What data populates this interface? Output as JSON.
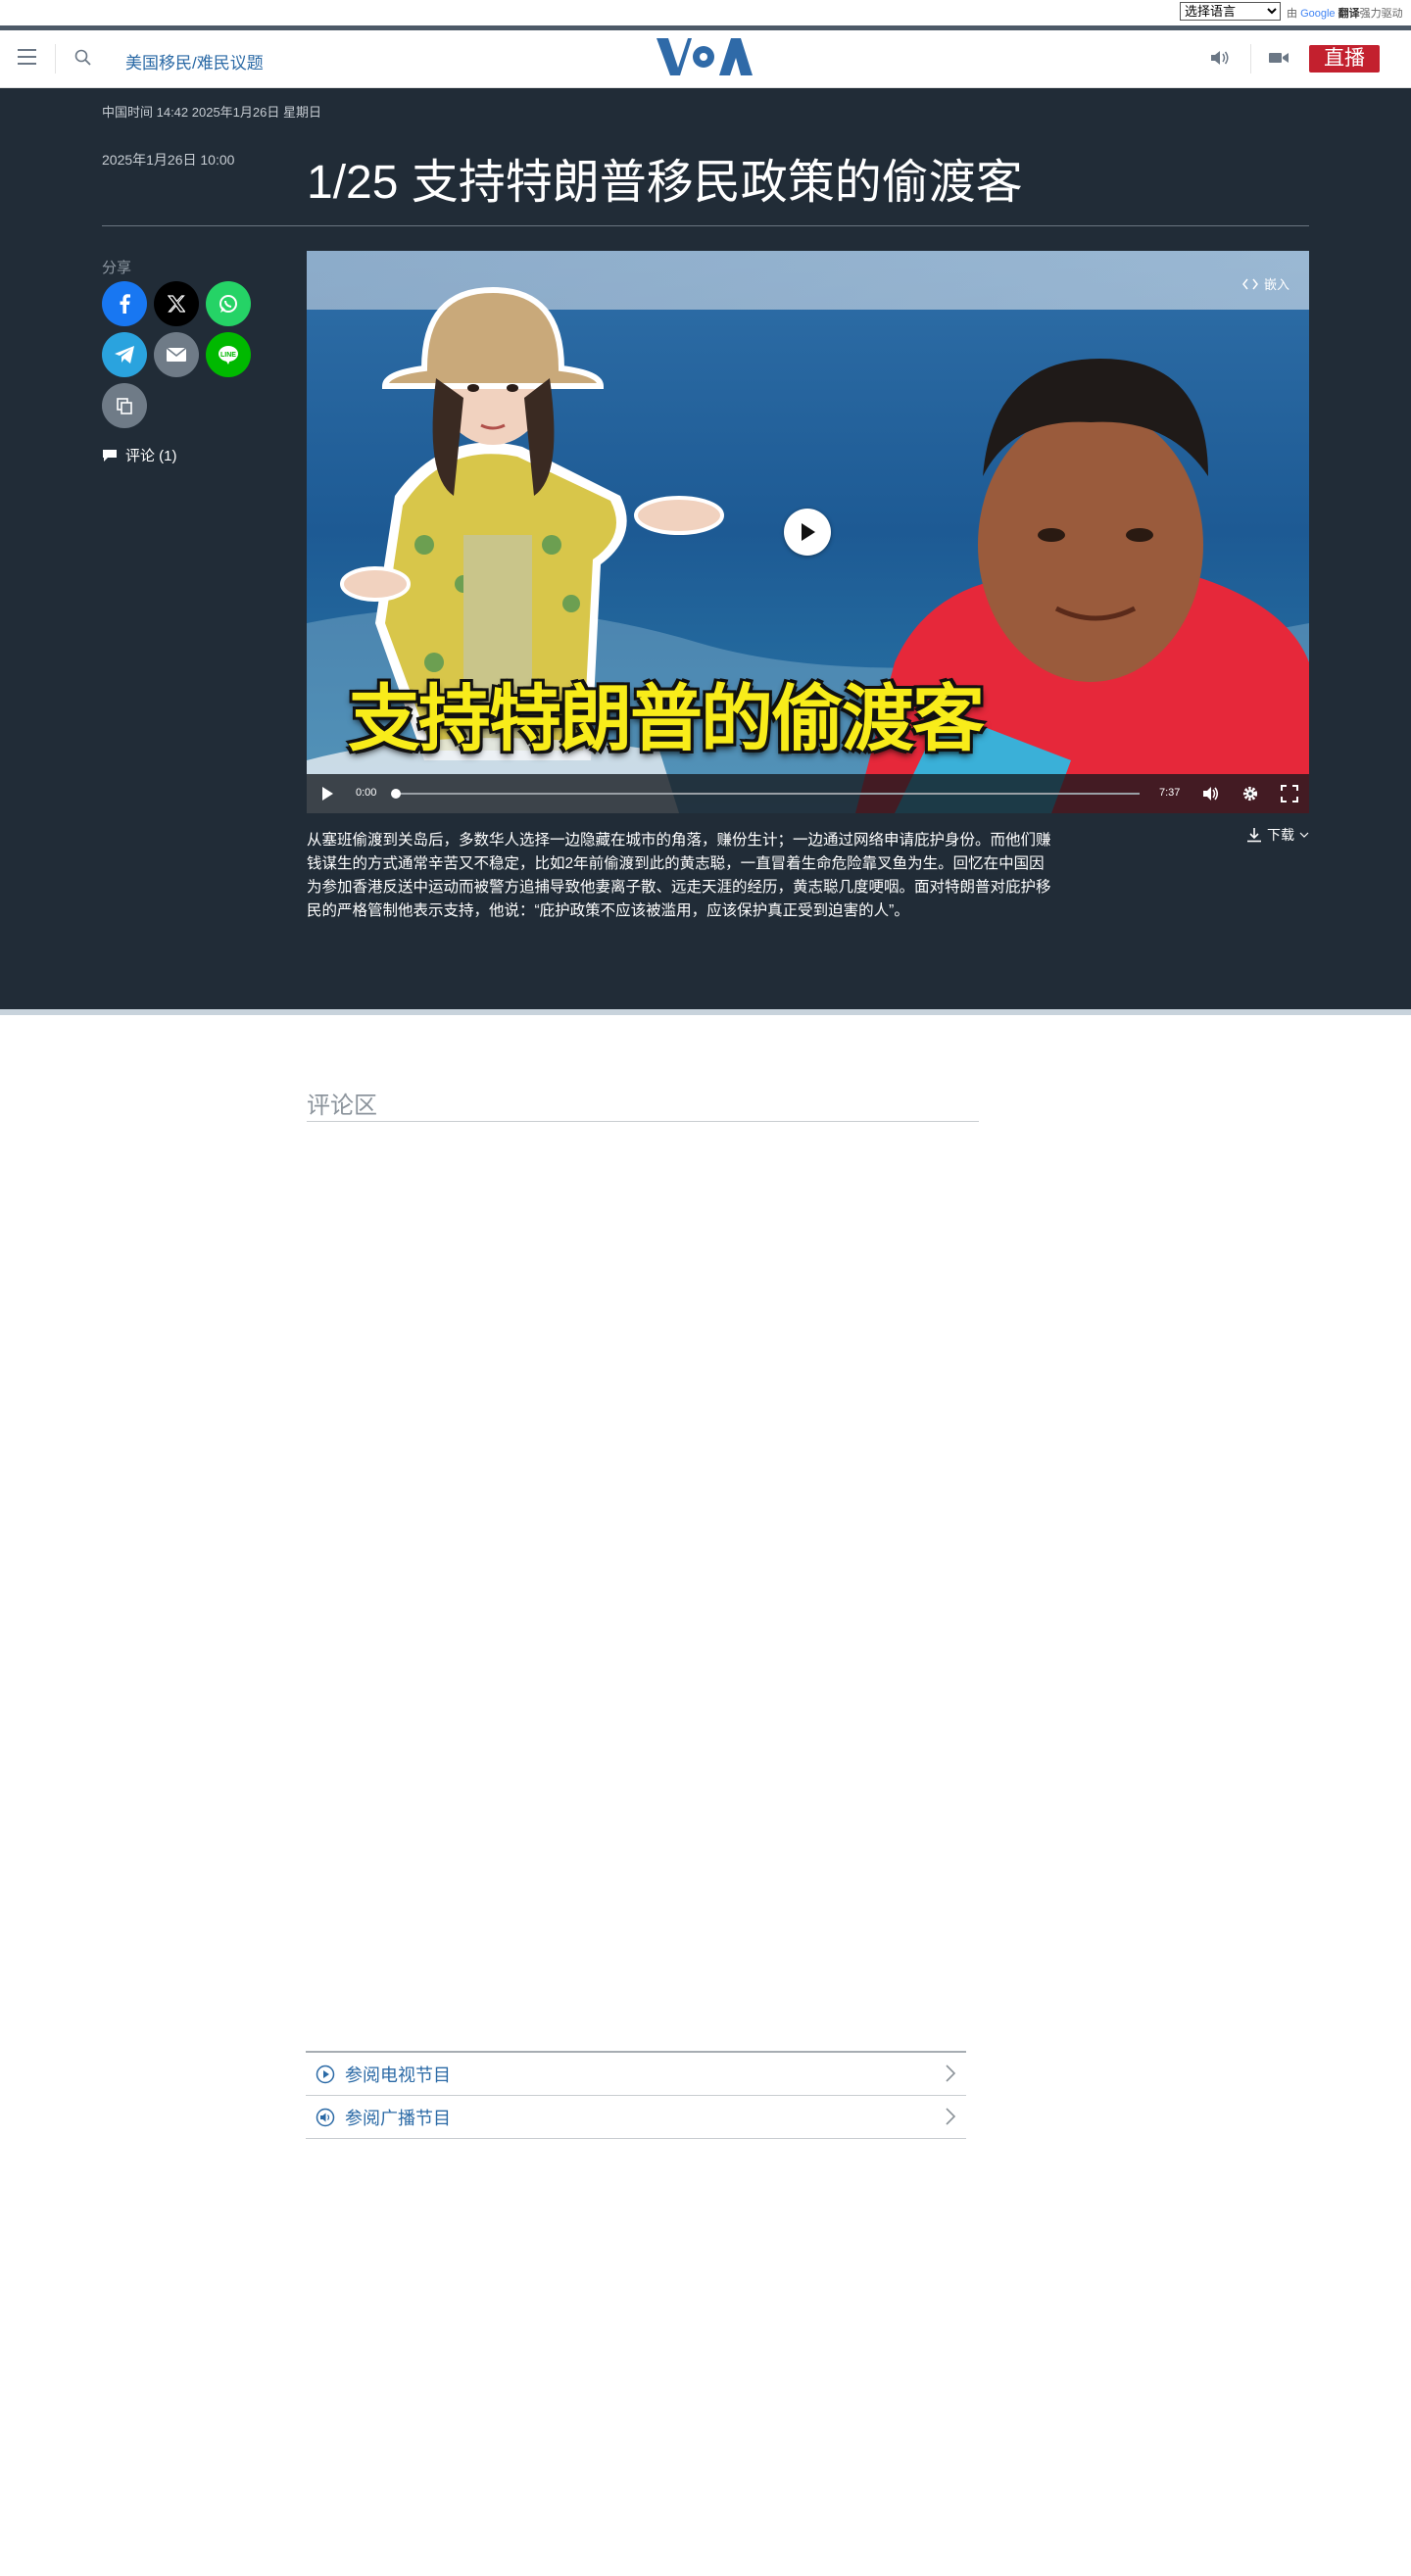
{
  "translate": {
    "select_value": "选择语言",
    "credit_prefix": "由",
    "credit_google": "Google",
    "credit_translate": "翻译",
    "credit_suffix": "强力驱动"
  },
  "header": {
    "section_link": "美国移民/难民议题",
    "logo_text": "VOA",
    "live_label": "直播",
    "icons": [
      "hamburger-icon",
      "search-icon",
      "speaker-icon",
      "video-camera-icon"
    ]
  },
  "article": {
    "timestamp_top": "中国时间 14:42 2025年1月26日 星期日",
    "date_published": "2025年1月26日 10:00",
    "title": "1/25 支持特朗普移民政策的偷渡客",
    "share_label": "分享",
    "share_buttons": [
      "facebook",
      "x",
      "whatsapp",
      "telegram",
      "email",
      "line",
      "copy-link"
    ],
    "comments_link": "评论 (1)",
    "description": "从塞班偷渡到关岛后，多数华人选择一边隐藏在城市的角落，赚份生计；一边通过网络申请庇护身份。而他们赚钱谋生的方式通常辛苦又不稳定，比如2年前偷渡到此的黄志聪，一直冒着生命危险靠叉鱼为生。回忆在中国因为参加香港反送中运动而被警方追捕导致他妻离子散、远走天涯的经历，黄志聪几度哽咽。面对特朗普对庇护移民的严格管制他表示支持，他说：“庇护政策不应该被滥用，应该保护真正受到迫害的人”。"
  },
  "video": {
    "overlay_text": "支持特朗普的偷渡客",
    "embed_label": "嵌入",
    "time_current": "0:00",
    "time_duration": "7:37",
    "progress": 0,
    "download_label": "下载"
  },
  "comments": {
    "heading": "评论区"
  },
  "links": [
    {
      "label": "参阅电视节目",
      "icon": "play-circle-icon"
    },
    {
      "label": "参阅广播节目",
      "icon": "speaker-circle-icon"
    }
  ],
  "colors": {
    "dark_bg": "#212c37",
    "live_red": "#c3202e",
    "link_blue": "#2b6aa6",
    "logo_blue": "#1f5f9e"
  }
}
